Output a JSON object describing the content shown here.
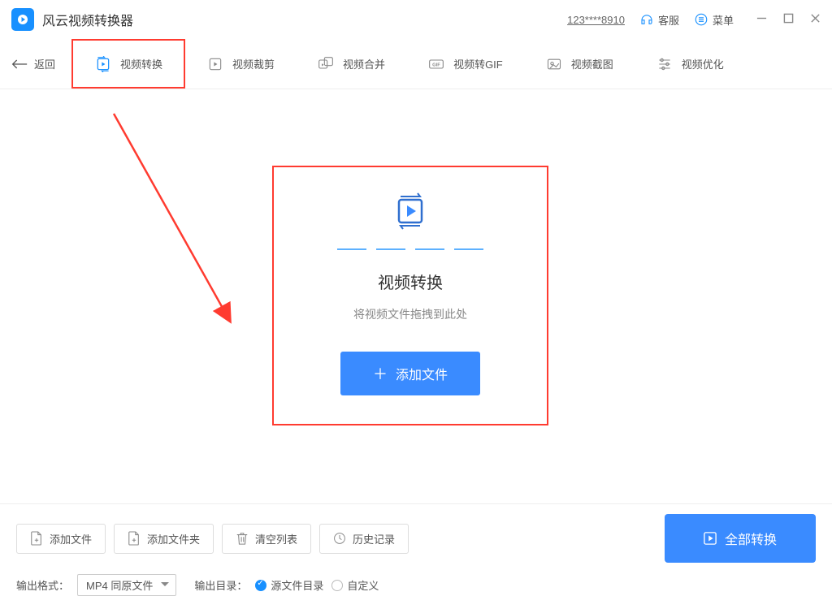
{
  "app": {
    "title": "风云视频转换器"
  },
  "titlebar": {
    "user_id": "123****8910",
    "support_label": "客服",
    "menu_label": "菜单"
  },
  "toolbar": {
    "back_label": "返回",
    "tabs": [
      {
        "label": "视频转换",
        "active": true
      },
      {
        "label": "视频裁剪"
      },
      {
        "label": "视频合并"
      },
      {
        "label": "视频转GIF"
      },
      {
        "label": "视频截图"
      },
      {
        "label": "视频优化"
      }
    ]
  },
  "center": {
    "title": "视频转换",
    "subtitle": "将视频文件拖拽到此处",
    "add_button": "添加文件"
  },
  "bottom": {
    "add_file": "添加文件",
    "add_folder": "添加文件夹",
    "clear_list": "清空列表",
    "history": "历史记录",
    "convert_all": "全部转换",
    "output_format_label": "输出格式：",
    "output_format_value": "MP4 同原文件",
    "output_dir_label": "输出目录：",
    "dir_source": "源文件目录",
    "dir_custom": "自定义"
  }
}
